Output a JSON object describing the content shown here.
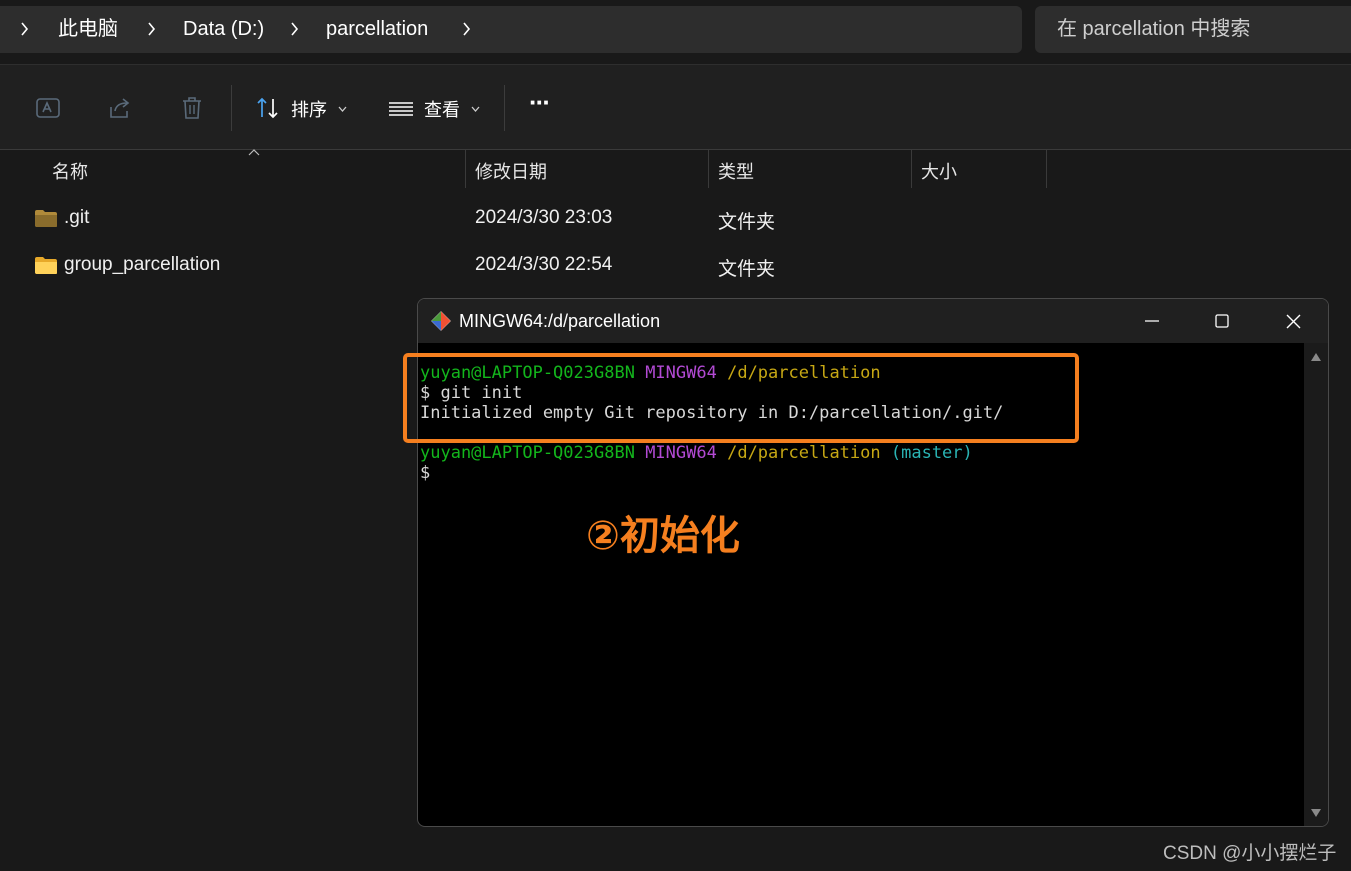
{
  "breadcrumb": [
    "此电脑",
    "Data (D:)",
    "parcellation"
  ],
  "search": {
    "placeholder": "在 parcellation 中搜索"
  },
  "toolbar": {
    "sort_label": "排序",
    "view_label": "查看",
    "more_label": "···"
  },
  "columns": [
    "名称",
    "修改日期",
    "类型",
    "大小"
  ],
  "files": [
    {
      "name": ".git",
      "modified": "2024/3/30 23:03",
      "type": "文件夹"
    },
    {
      "name": "group_parcellation",
      "modified": "2024/3/30 22:54",
      "type": "文件夹"
    }
  ],
  "terminal": {
    "title": "MINGW64:/d/parcellation",
    "lines": [
      {
        "user": "yuyan@LAPTOP-Q023G8BN",
        "env": "MINGW64",
        "path": "/d/parcellation",
        "branch": ""
      },
      {
        "text": "$ git init"
      },
      {
        "text": "Initialized empty Git repository in D:/parcellation/.git/"
      },
      {
        "user": "yuyan@LAPTOP-Q023G8BN",
        "env": "MINGW64",
        "path": "/d/parcellation",
        "branch": "(master)"
      },
      {
        "text": "$"
      }
    ]
  },
  "annotation": "②初始化",
  "watermark": "CSDN @小小摆烂子",
  "colors": {
    "accent_annotation": "#f57f1f",
    "prompt_user": "#13b51c",
    "prompt_env": "#b24ad4",
    "prompt_path": "#c6a714",
    "prompt_branch": "#2ab3b3"
  }
}
